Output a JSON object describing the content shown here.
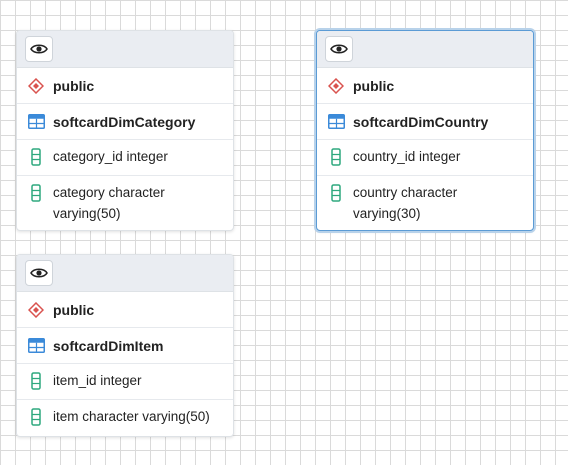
{
  "nodes": [
    {
      "schema": "public",
      "table": "softcardDimCategory",
      "columns": [
        "category_id integer",
        "category character varying(50)"
      ]
    },
    {
      "schema": "public",
      "table": "softcardDimCountry",
      "columns": [
        "country_id integer",
        "country character varying(30)"
      ]
    },
    {
      "schema": "public",
      "table": "softcardDimItem",
      "columns": [
        "item_id integer",
        "item character varying(50)"
      ]
    }
  ],
  "icons": {
    "toggle": "eye-icon",
    "schema": "schema-diamond-icon",
    "table": "table-grid-icon",
    "column": "column-icon"
  },
  "colors": {
    "schema_icon": "#d9534f",
    "table_icon": "#3b8ad9",
    "column_icon": "#2ea87e",
    "selected_border": "#5b9bd5"
  }
}
